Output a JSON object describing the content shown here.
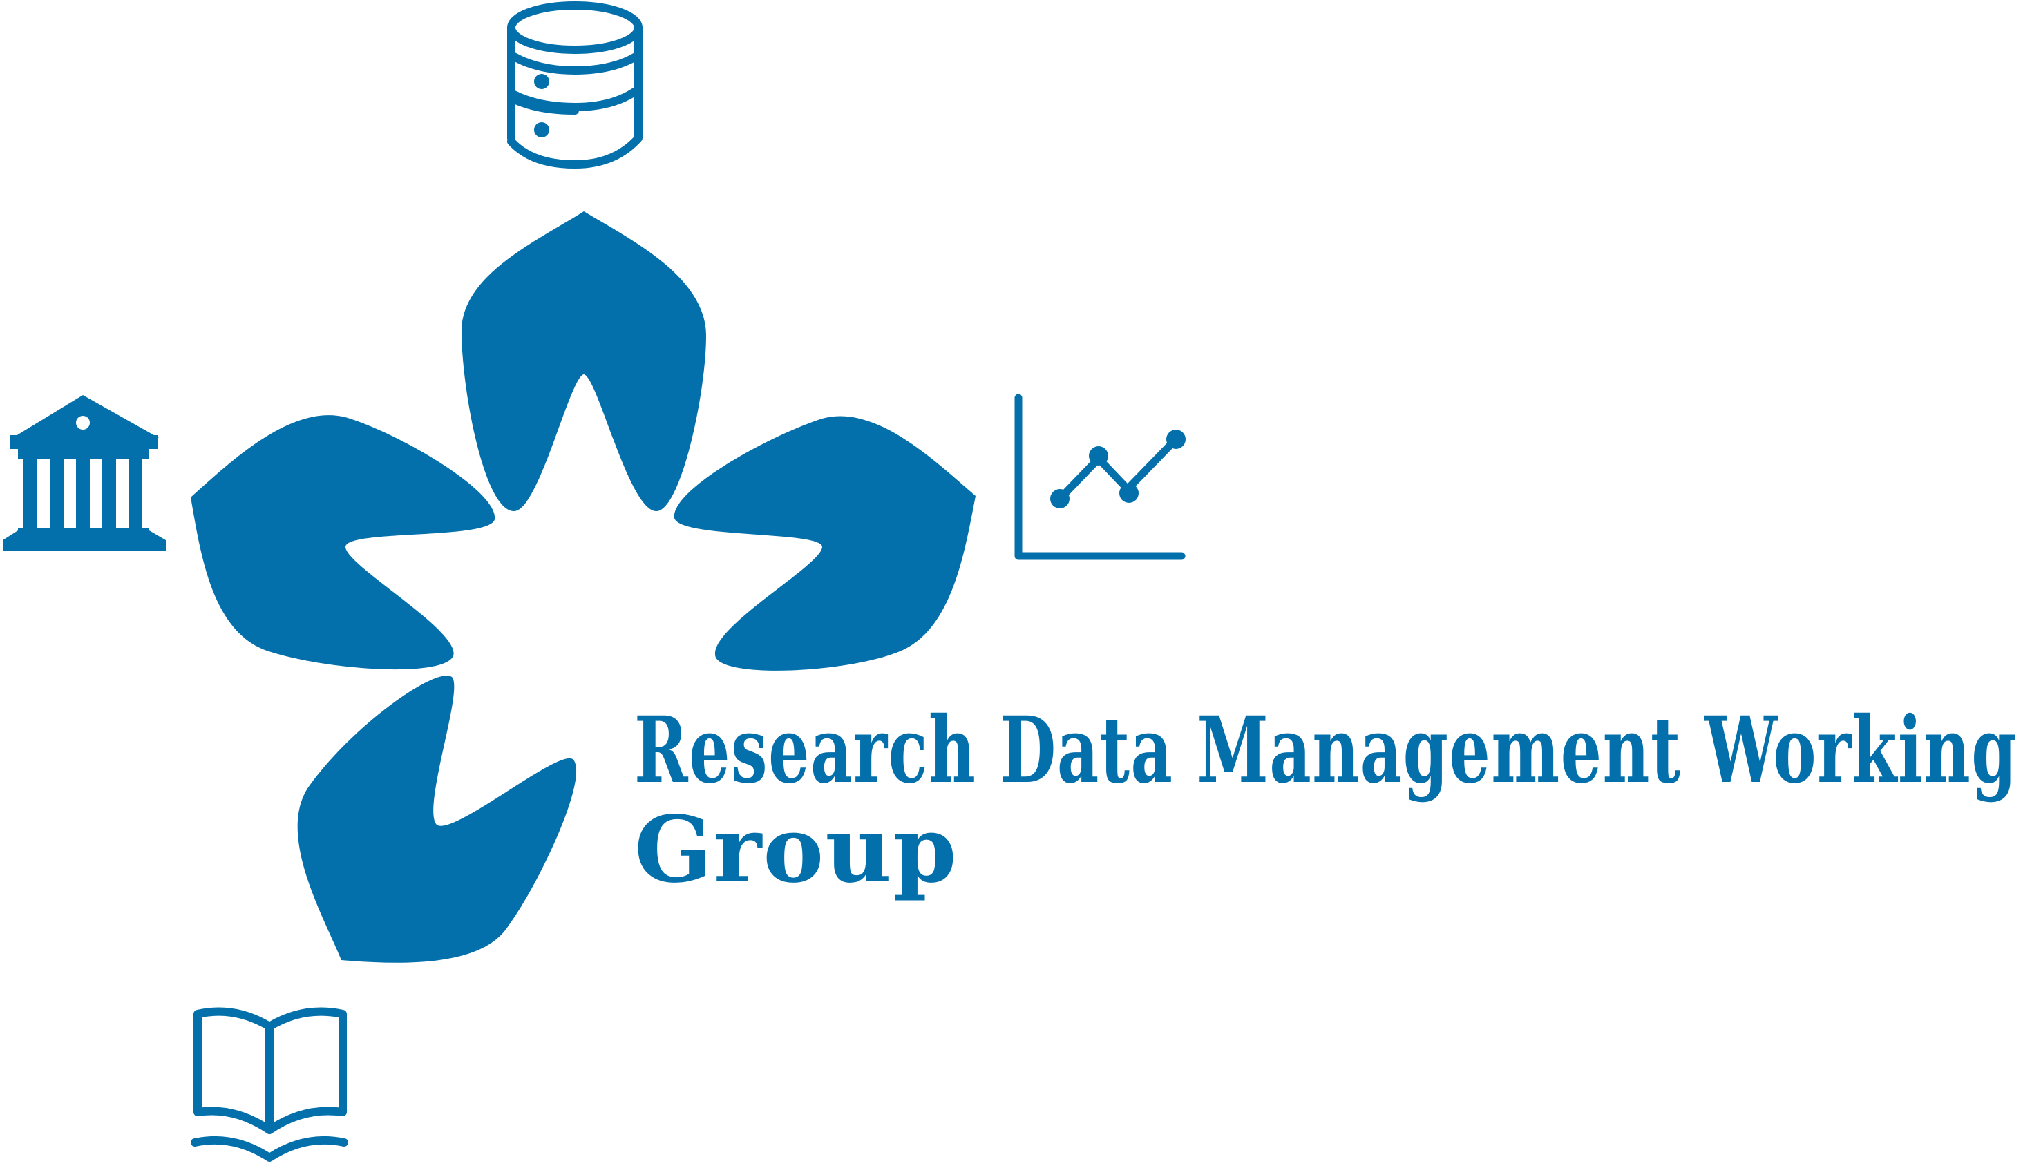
{
  "logo": {
    "title_line1": "Research Data Management Working",
    "title_line2": "Group",
    "brand_color": "#0470AB",
    "icons": {
      "database": "database-icon",
      "institution": "institution-building-icon",
      "chart": "line-chart-icon",
      "book": "open-book-icon"
    }
  }
}
